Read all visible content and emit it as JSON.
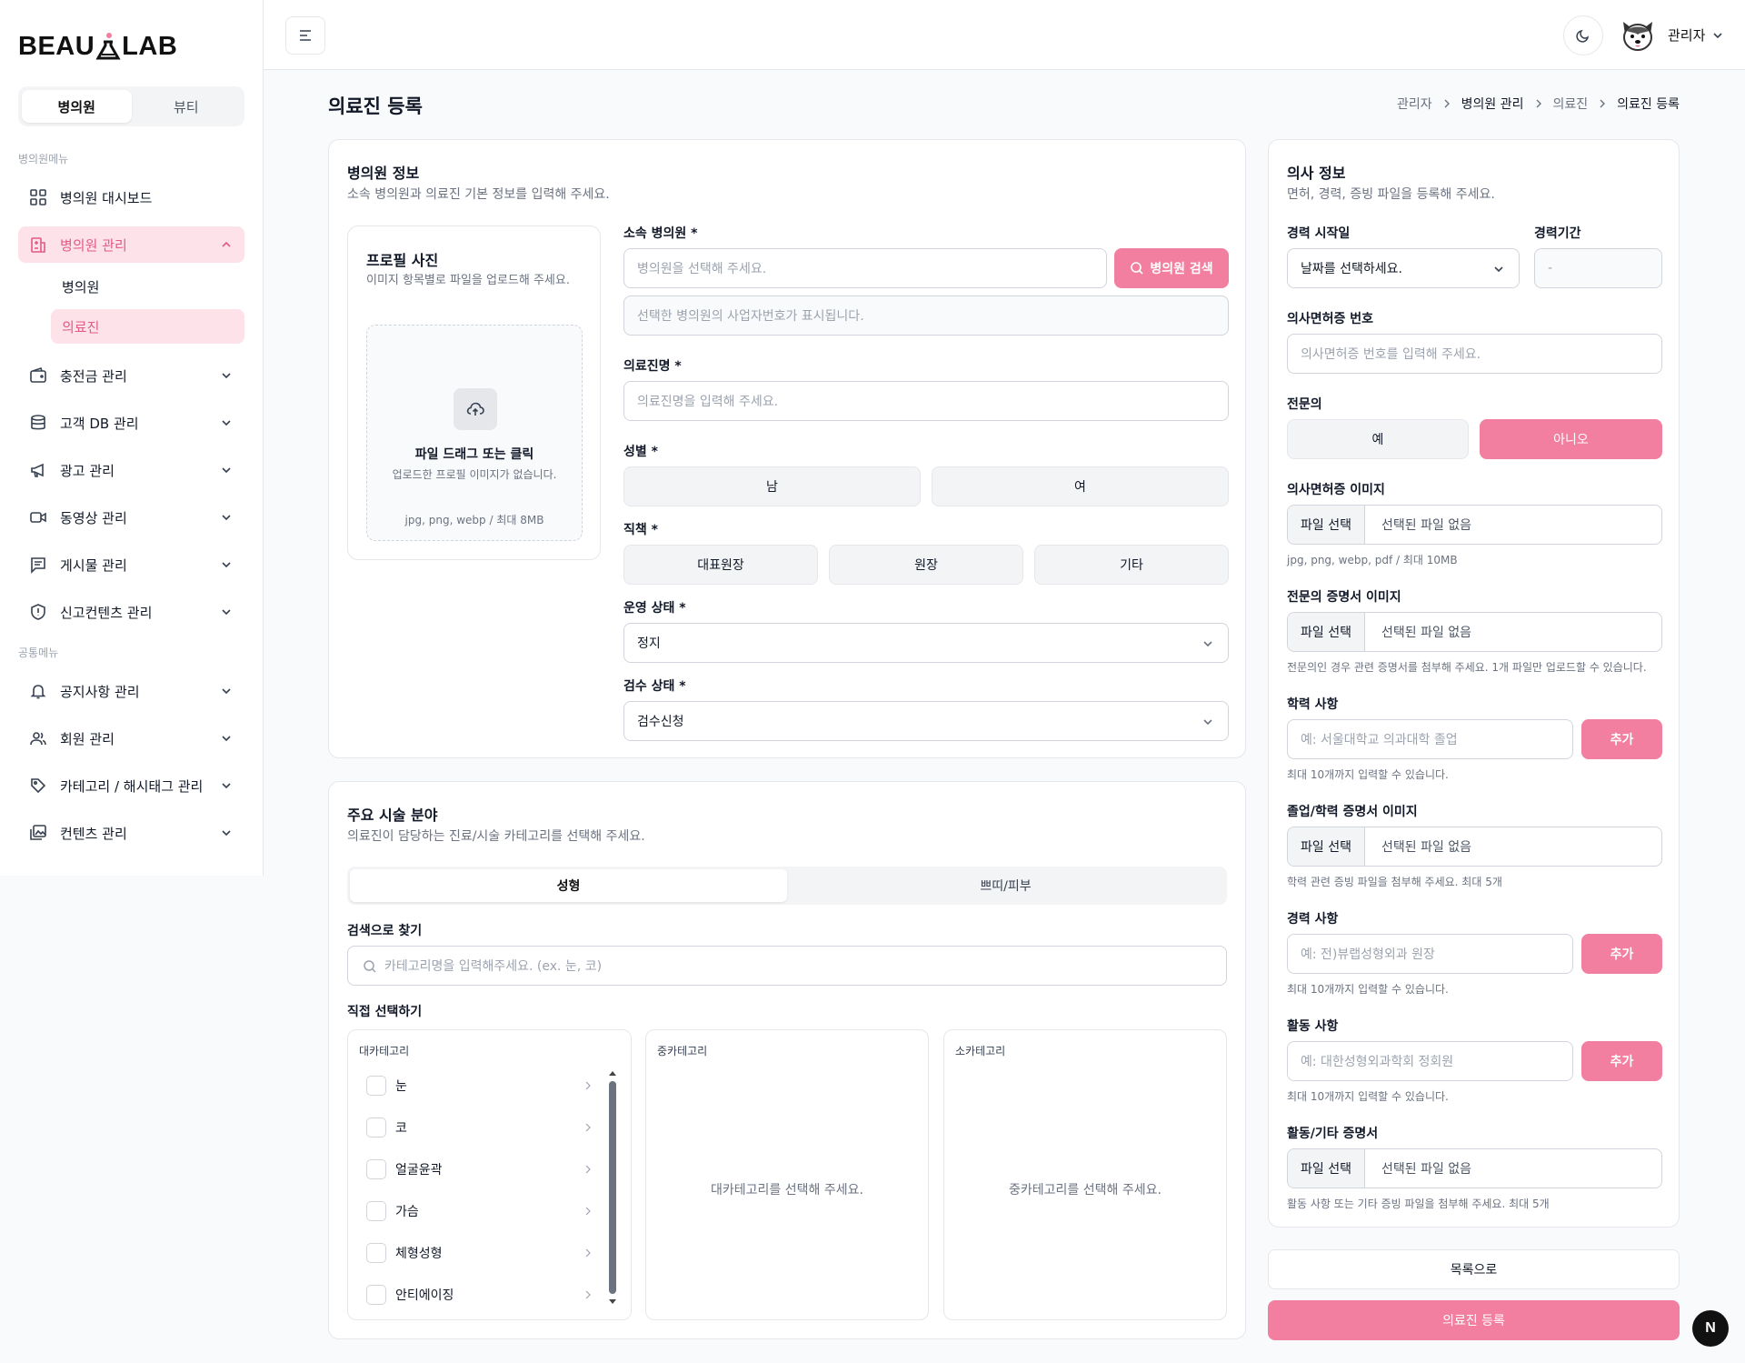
{
  "logo": {
    "text_left": "BEAU",
    "text_right": "LAB"
  },
  "sidebar": {
    "toggle": {
      "hospital": "병의원",
      "beauty": "뷰티"
    },
    "section1": "병의원메뉴",
    "section2": "공통메뉴",
    "items": [
      {
        "label": "병의원 대시보드"
      },
      {
        "label": "병의원 관리"
      },
      {
        "label": "충전금 관리"
      },
      {
        "label": "고객 DB 관리"
      },
      {
        "label": "광고 관리"
      },
      {
        "label": "동영상 관리"
      },
      {
        "label": "게시물 관리"
      },
      {
        "label": "신고컨텐츠 관리"
      },
      {
        "label": "공지사항 관리"
      },
      {
        "label": "회원 관리"
      },
      {
        "label": "카테고리 / 해시태그 관리"
      },
      {
        "label": "컨텐츠 관리"
      }
    ],
    "subitems": [
      {
        "label": "병의원"
      },
      {
        "label": "의료진"
      }
    ]
  },
  "header": {
    "user": "관리자"
  },
  "page": {
    "title": "의료진 등록",
    "breadcrumb": [
      "관리자",
      "병의원 관리",
      "의료진",
      "의료진 등록"
    ]
  },
  "clinic_card": {
    "title": "병의원 정보",
    "desc": "소속 병의원과 의료진 기본 정보를 입력해 주세요.",
    "photo": {
      "title": "프로필 사진",
      "desc": "이미지 항목별로 파일을 업로드해 주세요.",
      "drop_title": "파일 드래그 또는 클릭",
      "drop_desc": "업로드한 프로필 이미지가 없습니다.",
      "drop_formats": "jpg, png, webp / 최대 8MB"
    },
    "hospital_label": "소속 병의원 *",
    "hospital_placeholder": "병의원을 선택해 주세요.",
    "hospital_search": "병의원 검색",
    "biz_placeholder": "선택한 병의원의 사업자번호가 표시됩니다.",
    "name_label": "의료진명 *",
    "name_placeholder": "의료진명을 입력해 주세요.",
    "gender_label": "성별 *",
    "gender_male": "남",
    "gender_female": "여",
    "position_label": "직책 *",
    "positions": [
      "대표원장",
      "원장",
      "기타"
    ],
    "status_label": "운영 상태 *",
    "status_value": "정지",
    "review_label": "검수 상태 *",
    "review_value": "검수신청"
  },
  "specialty_card": {
    "title": "주요 시술 분야",
    "desc": "의료진이 담당하는 진료/시술 카테고리를 선택해 주세요.",
    "tabs": [
      "성형",
      "쁘띠/피부"
    ],
    "search_label": "검색으로 찾기",
    "search_placeholder": "카테고리명을 입력해주세요. (ex. 눈, 코)",
    "direct_label": "직접 선택하기",
    "col_large": "대카테고리",
    "col_mid": "중카테고리",
    "col_small": "소카테고리",
    "mid_empty": "대카테고리를 선택해 주세요.",
    "small_empty": "중카테고리를 선택해 주세요.",
    "categories": [
      "눈",
      "코",
      "얼굴윤곽",
      "가슴",
      "체형성형",
      "안티에이징"
    ]
  },
  "doctor_card": {
    "title": "의사 정보",
    "desc": "면허, 경력, 증빙 파일을 등록해 주세요.",
    "start_label": "경력 시작일",
    "start_value": "날짜를 선택하세요.",
    "period_label": "경력기간",
    "period_value": "-",
    "license_label": "의사면허증 번호",
    "license_placeholder": "의사면허증 번호를 입력해 주세요.",
    "specialist_label": "전문의",
    "specialist_yes": "예",
    "specialist_no": "아니오",
    "license_img_label": "의사면허증 이미지",
    "file_button": "파일 선택",
    "file_none": "선택된 파일 없음",
    "license_img_hint": "jpg, png, webp, pdf / 최대 10MB",
    "specialist_img_label": "전문의 증명서 이미지",
    "specialist_img_hint": "전문의인 경우 관련 증명서를 첨부해 주세요. 1개 파일만 업로드할 수 있습니다.",
    "edu_label": "학력 사항",
    "edu_placeholder": "예: 서울대학교 의과대학 졸업",
    "add": "추가",
    "max_hint": "최대 10개까지 입력할 수 있습니다.",
    "grad_img_label": "졸업/학력 증명서 이미지",
    "grad_img_hint": "학력 관련 증빙 파일을 첨부해 주세요. 최대 5개",
    "career_label": "경력 사항",
    "career_placeholder": "예: 전)뷰랩성형외과 원장",
    "activity_label": "활동 사항",
    "activity_placeholder": "예: 대한성형외과학회 정회원",
    "activity_cert_label": "활동/기타 증명서",
    "activity_cert_hint": "활동 사항 또는 기타 증빙 파일을 첨부해 주세요. 최대 5개"
  },
  "actions": {
    "list": "목록으로",
    "submit": "의료진 등록"
  },
  "badge": "N",
  "colors": {
    "accent": "#f27ea0",
    "accent_soft": "#fde2ea",
    "accent_text": "#e15b85"
  }
}
